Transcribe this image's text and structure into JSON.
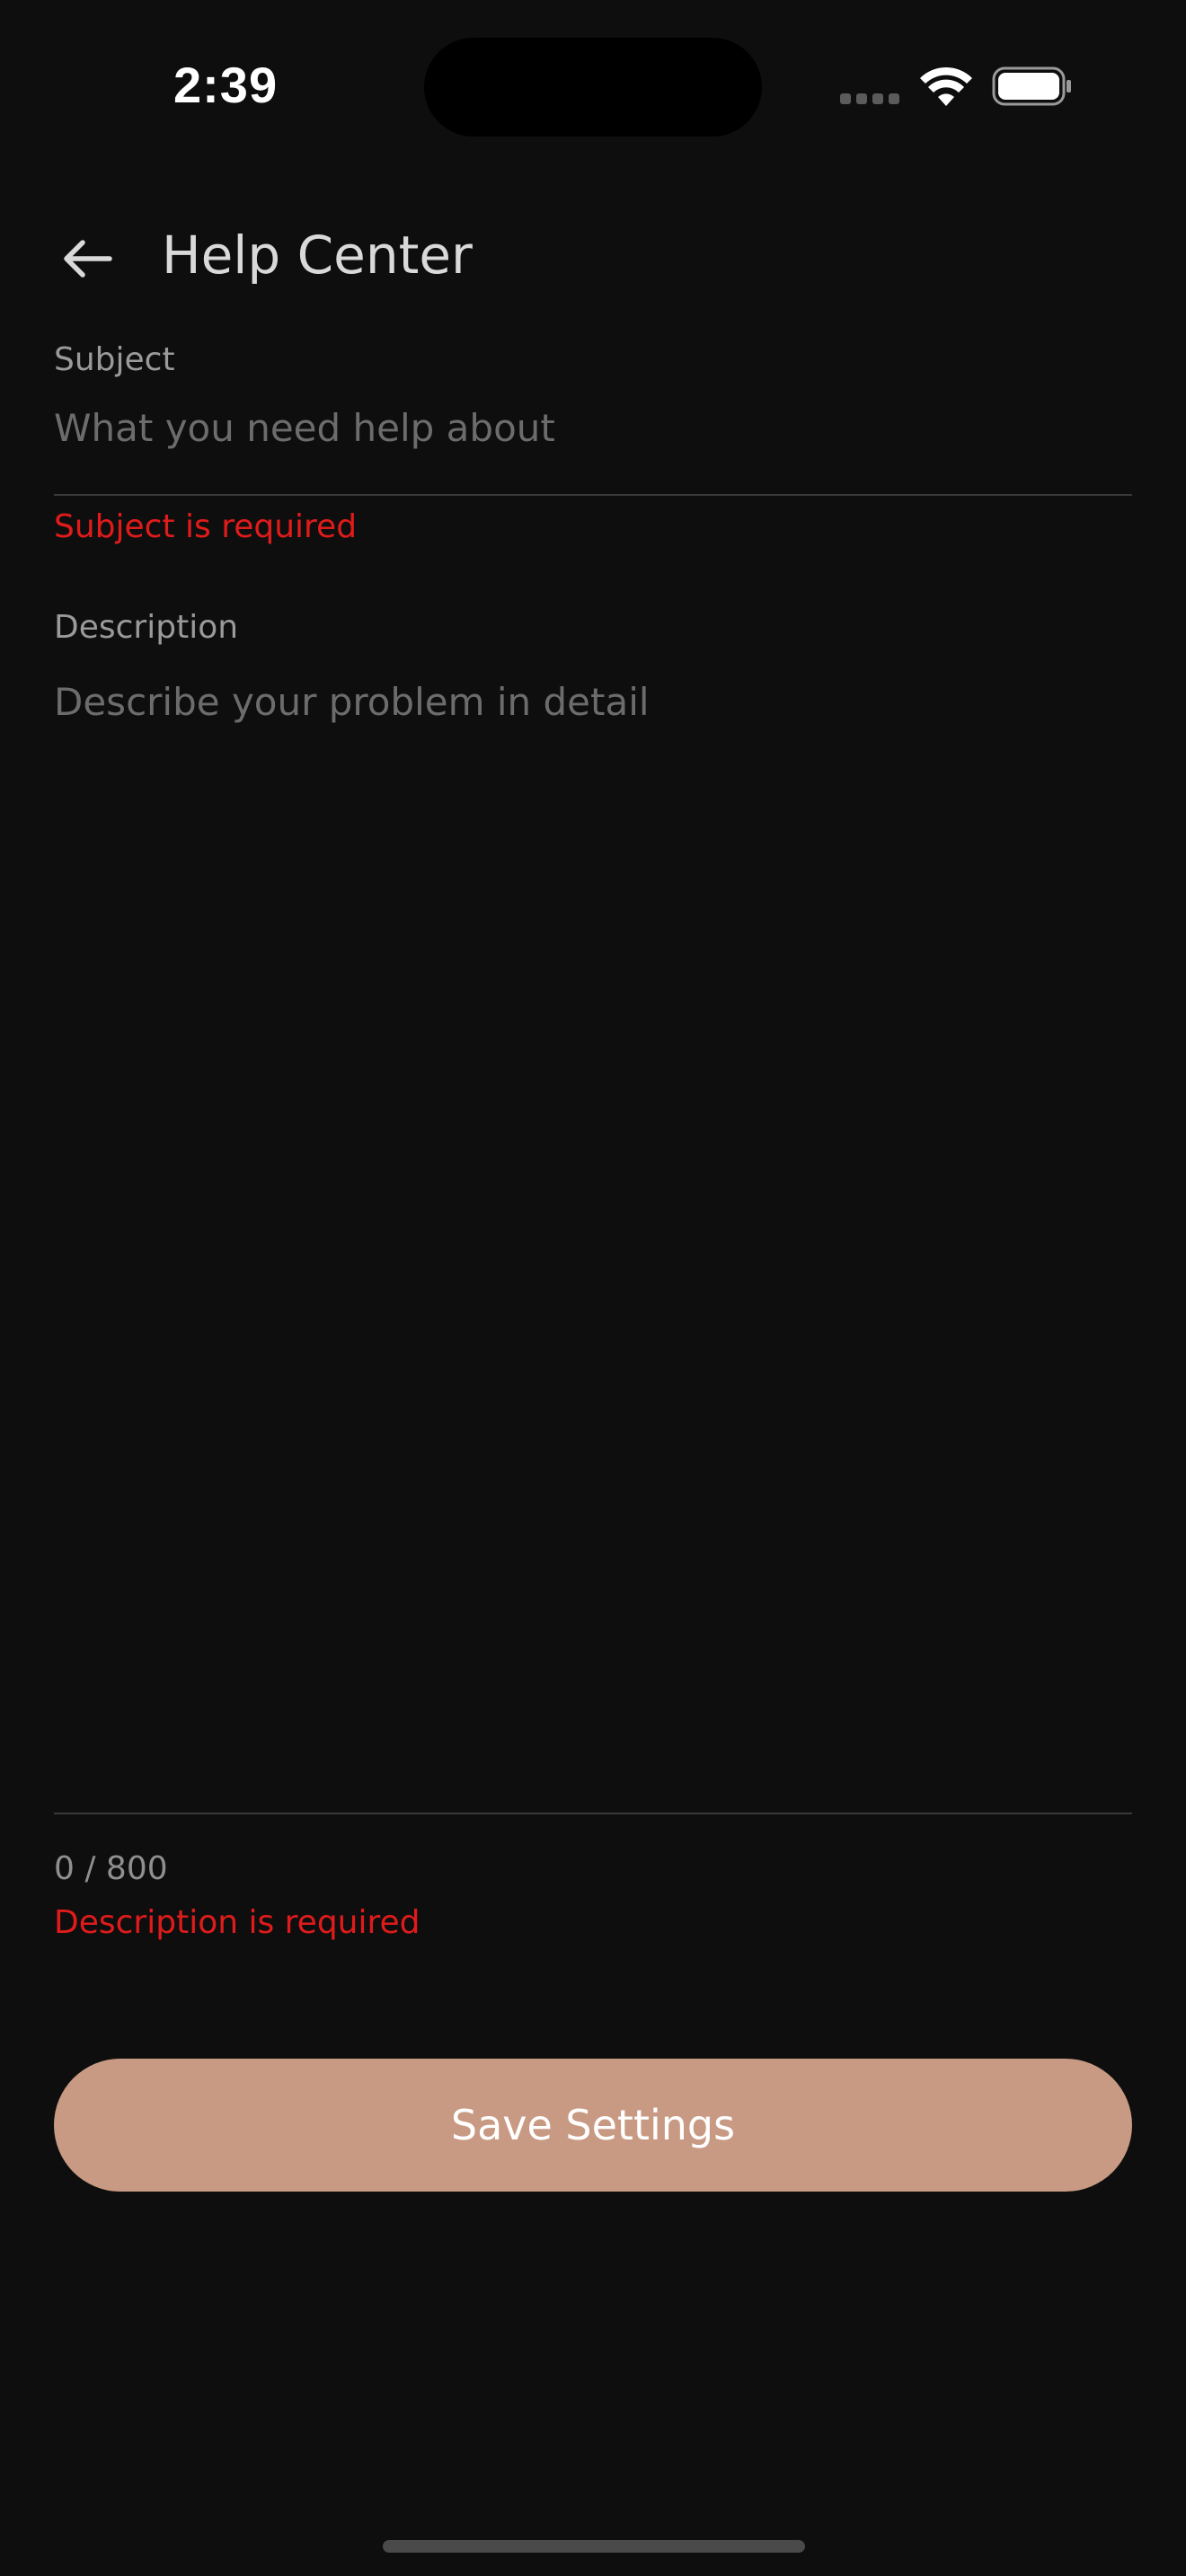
{
  "status_bar": {
    "time": "2:39"
  },
  "header": {
    "back_icon": "arrow-left-icon",
    "title": "Help Center"
  },
  "form": {
    "subject": {
      "label": "Subject",
      "placeholder": "What you need help about",
      "value": "",
      "error": "Subject is required"
    },
    "description": {
      "label": "Description",
      "placeholder": "Describe your problem in detail",
      "value": "",
      "counter": "0 / 800",
      "error": "Description is required"
    }
  },
  "actions": {
    "save_label": "Save Settings"
  },
  "colors": {
    "background": "#0e0e0e",
    "accent": "#c99a83",
    "error": "#e01b1b"
  }
}
